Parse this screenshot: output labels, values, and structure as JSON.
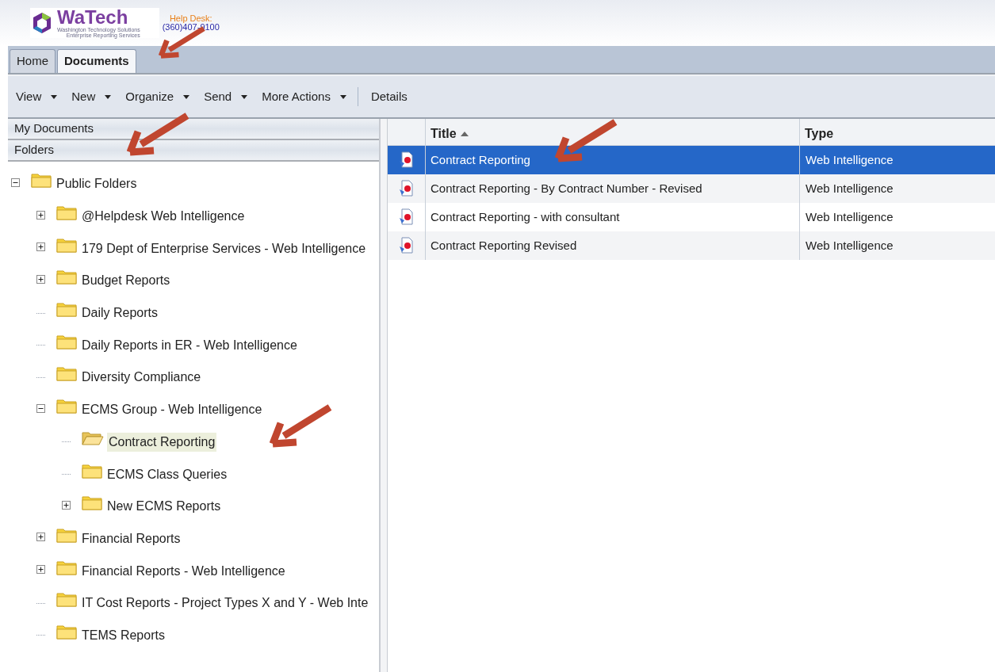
{
  "header": {
    "logo": {
      "name": "WaTech",
      "tagline_1": "Washington Technology Solutions",
      "tagline_2": "Enterprise Reporting Services"
    },
    "help_desk": {
      "label": "Help Desk:",
      "phone": "(360)407-9100"
    }
  },
  "tabs": [
    {
      "label": "Home",
      "selected": false
    },
    {
      "label": "Documents",
      "selected": true
    }
  ],
  "toolbar": {
    "menus": [
      "View",
      "New",
      "Organize",
      "Send",
      "More Actions"
    ],
    "buttons": [
      "Details"
    ]
  },
  "sidebar": {
    "sections": [
      {
        "label": "My Documents"
      },
      {
        "label": "Folders"
      }
    ],
    "tree": [
      {
        "label": "Public Folders",
        "expanded": true,
        "selected": false,
        "children": [
          {
            "label": "@Helpdesk Web Intelligence",
            "expanded": false,
            "selected": false
          },
          {
            "label": "179 Dept of Enterprise Services - Web Intelligence",
            "expanded": false,
            "selected": false
          },
          {
            "label": "Budget Reports",
            "expanded": false,
            "selected": false
          },
          {
            "label": "Daily Reports",
            "selected": false
          },
          {
            "label": "Daily Reports in ER - Web Intelligence",
            "selected": false
          },
          {
            "label": "Diversity Compliance",
            "selected": false
          },
          {
            "label": "ECMS Group - Web Intelligence",
            "expanded": true,
            "selected": false,
            "children": [
              {
                "label": "Contract Reporting",
                "selected": true
              },
              {
                "label": "ECMS Class Queries",
                "selected": false
              },
              {
                "label": "New ECMS Reports",
                "expanded": false,
                "selected": false
              }
            ]
          },
          {
            "label": "Financial Reports",
            "expanded": false,
            "selected": false
          },
          {
            "label": "Financial Reports - Web Intelligence",
            "expanded": false,
            "selected": false
          },
          {
            "label": "IT Cost Reports - Project Types X and Y - Web Inte",
            "selected": false
          },
          {
            "label": "TEMS Reports",
            "selected": false
          }
        ]
      }
    ]
  },
  "table": {
    "columns": [
      {
        "label": "Title",
        "sorted_ascending": true
      },
      {
        "label": "Type"
      }
    ],
    "rows": [
      {
        "title": "Contract Reporting",
        "type": "Web Intelligence",
        "selected": true
      },
      {
        "title": "Contract Reporting - By Contract Number - Revised",
        "type": "Web Intelligence",
        "selected": false
      },
      {
        "title": "Contract Reporting - with consultant",
        "type": "Web Intelligence",
        "selected": false
      },
      {
        "title": "Contract Reporting Revised",
        "type": "Web Intelligence",
        "selected": false
      }
    ]
  }
}
